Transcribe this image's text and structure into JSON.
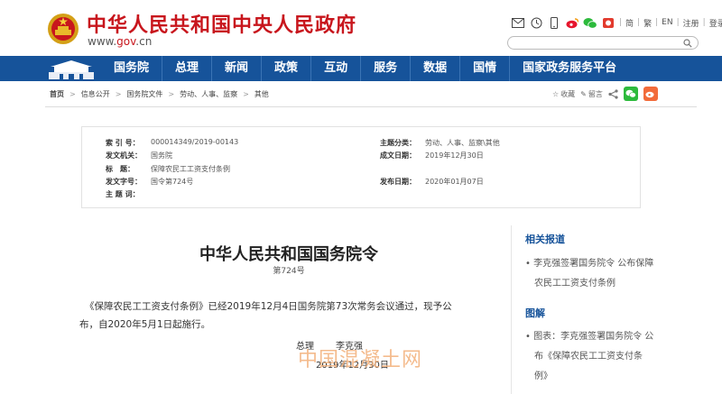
{
  "header": {
    "title": "中华人民共和国中央人民政府",
    "domain_prefix": "www.",
    "domain_red": "gov",
    "domain_suffix": ".cn",
    "util_links": [
      "简",
      "繁",
      "EN",
      "注册",
      "登录"
    ]
  },
  "nav": {
    "items": [
      "国务院",
      "总理",
      "新闻",
      "政策",
      "互动",
      "服务",
      "数据",
      "国情",
      "国家政务服务平台"
    ]
  },
  "breadcrumb": [
    "首页",
    "信息公开",
    "国务院文件",
    "劳动、人事、监察",
    "其他"
  ],
  "tools": {
    "favorite": "收藏",
    "message": "留言"
  },
  "meta": {
    "index_label": "索 引 号：",
    "index": "000014349/2019-00143",
    "topic_label": "主题分类：",
    "topic": "劳动、人事、监察\\其他",
    "org_label": "发文机关：",
    "org": "国务院",
    "date_label": "成文日期：",
    "date": "2019年12月30日",
    "title_label": "标　题：",
    "title": "保障农民工工资支付条例",
    "doc_no_label": "发文字号：",
    "doc_no": "国令第724号",
    "pub_label": "发布日期：",
    "pub": "2020年01月07日",
    "keyword_label": "主 题 词：",
    "keyword": ""
  },
  "article": {
    "title": "中华人民共和国国务院令",
    "number": "第724号",
    "para_line1": "《保障农民工工资支付条例》已经2019年12月4日国务院第73次常务会议通过，现予公",
    "para_line2": "布，自2020年5月1日起施行。",
    "sign_role": "总理",
    "sign_name": "李克强",
    "sign_date": "2019年12月30日"
  },
  "sidebar": {
    "related_heading": "相关报道",
    "related_line1": "李克强签署国务院令 公布保障",
    "related_line2": "农民工工资支付条例",
    "graphic_heading": "图解",
    "graphic_line1": "图表：李克强签署国务院令 公",
    "graphic_line2": "布《保障农民工工资支付条",
    "graphic_line3": "例》"
  },
  "watermark": "中国混凝土网",
  "colors": {
    "brand_red": "#c8161d",
    "nav_blue": "#16539a",
    "wechat_green": "#2dba3c",
    "weibo_orange": "#f26b3a"
  }
}
